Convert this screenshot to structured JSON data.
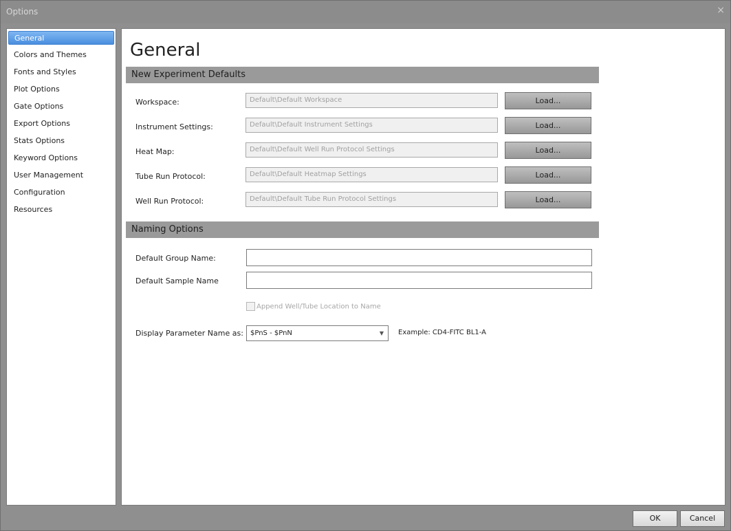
{
  "window": {
    "title": "Options",
    "close_glyph": "×"
  },
  "sidebar": {
    "items": [
      {
        "label": "General",
        "selected": true
      },
      {
        "label": "Colors and Themes"
      },
      {
        "label": "Fonts and Styles"
      },
      {
        "label": "Plot Options"
      },
      {
        "label": "Gate Options"
      },
      {
        "label": "Export Options"
      },
      {
        "label": "Stats Options"
      },
      {
        "label": "Keyword Options"
      },
      {
        "label": "User Management"
      },
      {
        "label": "Configuration"
      },
      {
        "label": "Resources"
      }
    ]
  },
  "main": {
    "title": "General",
    "experiment_section": {
      "header": "New Experiment Defaults",
      "load_label": "Load...",
      "rows": [
        {
          "label": "Workspace:",
          "value": "Default\\Default Workspace"
        },
        {
          "label": "Instrument Settings:",
          "value": "Default\\Default Instrument Settings"
        },
        {
          "label": "Heat Map:",
          "value": "Default\\Default Well Run Protocol Settings"
        },
        {
          "label": "Tube Run Protocol:",
          "value": "Default\\Default Heatmap Settings"
        },
        {
          "label": "Well Run Protocol:",
          "value": "Default\\Default Tube Run Protocol Settings"
        }
      ]
    },
    "naming_section": {
      "header": "Naming Options",
      "group_name_label": "Default Group Name:",
      "group_name_value": "",
      "sample_name_label": "Default Sample Name",
      "sample_name_value": "",
      "append_location_label": "Append Well/Tube Location to Name",
      "append_location_checked": false,
      "param_name_label": "Display Parameter Name as:",
      "param_name_selected": "$PnS - $PnN",
      "example_text": "Example: CD4-FITC BL1-A"
    }
  },
  "footer": {
    "ok_label": "OK",
    "cancel_label": "Cancel"
  }
}
